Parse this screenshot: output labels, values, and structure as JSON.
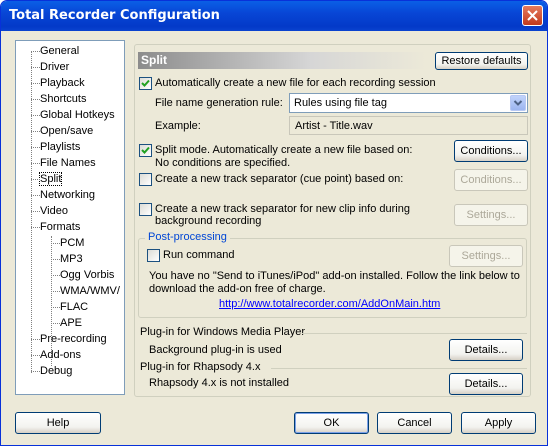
{
  "window": {
    "title": "Total Recorder Configuration"
  },
  "tree": {
    "items": [
      {
        "label": "General"
      },
      {
        "label": "Driver"
      },
      {
        "label": "Playback"
      },
      {
        "label": "Shortcuts"
      },
      {
        "label": "Global Hotkeys"
      },
      {
        "label": "Open/save"
      },
      {
        "label": "Playlists"
      },
      {
        "label": "File Names"
      },
      {
        "label": "Split"
      },
      {
        "label": "Networking"
      },
      {
        "label": "Video"
      },
      {
        "label": "Formats"
      },
      {
        "label": "PCM"
      },
      {
        "label": "MP3"
      },
      {
        "label": "Ogg Vorbis"
      },
      {
        "label": "WMA/WMV/"
      },
      {
        "label": "FLAC"
      },
      {
        "label": "APE"
      },
      {
        "label": "Pre-recording"
      },
      {
        "label": "Add-ons"
      },
      {
        "label": "Debug"
      }
    ],
    "selected": "Split"
  },
  "split": {
    "header": "Split",
    "restore_label": "Restore defaults",
    "auto_create_label": "Automatically create a new file for each recording session",
    "auto_create_checked": true,
    "rule_label": "File name generation rule:",
    "rule_value": "Rules using file tag",
    "example_label": "Example:",
    "example_value": "Artist - Title.wav",
    "split_mode_label": "Split mode. Automatically create a new file based on:",
    "split_mode_checked": true,
    "split_mode_status": "No conditions are specified.",
    "conditions_label": "Conditions...",
    "cue_label": "Create a new track separator (cue point) based on:",
    "cue_checked": false,
    "cue_conditions_label": "Conditions...",
    "clip_label_line1": "Create a new track separator for new clip info during",
    "clip_label_line2": "background recording",
    "clip_checked": false,
    "clip_settings_label": "Settings..."
  },
  "post": {
    "legend": "Post-processing",
    "run_command_label": "Run command",
    "run_command_checked": false,
    "settings_label": "Settings...",
    "info_line1": "You have no \"Send to iTunes/iPod\" add-on installed. Follow the link below to",
    "info_line2": "download the add-on free of charge.",
    "link": "http://www.totalrecorder.com/AddOnMain.htm"
  },
  "plugins": {
    "wmp_title": "Plug-in for Windows Media Player",
    "wmp_status": "Background plug-in is used",
    "wmp_details_label": "Details...",
    "rhapsody_title": "Plug-in for Rhapsody 4.x",
    "rhapsody_status": "Rhapsody 4.x is not installed",
    "rhapsody_details_label": "Details..."
  },
  "footer": {
    "help_label": "Help",
    "ok_label": "OK",
    "cancel_label": "Cancel",
    "apply_label": "Apply"
  },
  "colors": {
    "titlebar": "#0a5fe6",
    "dialog_bg": "#ece9d8",
    "link": "#0000ff",
    "legend": "#0046d5"
  }
}
